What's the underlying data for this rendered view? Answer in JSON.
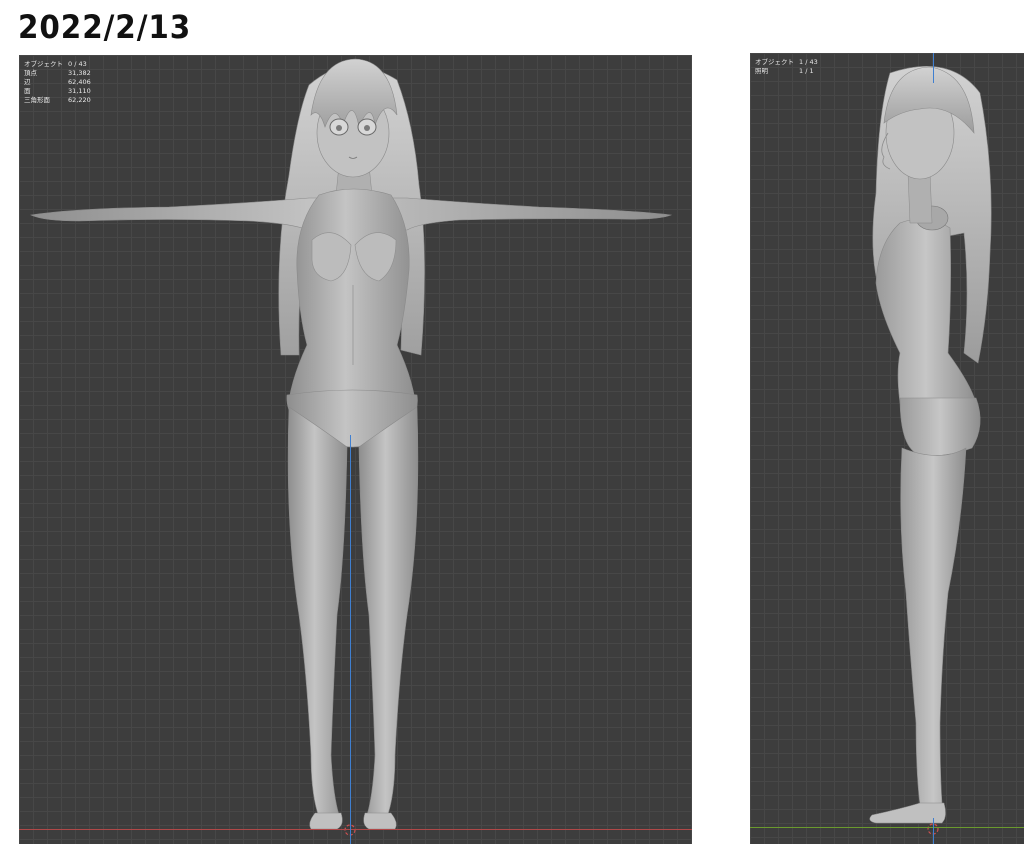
{
  "header": {
    "date": "2022/2/13"
  },
  "front_view": {
    "stats": [
      {
        "label": "オブジェクト",
        "value": "0 / 43"
      },
      {
        "label": "頂点",
        "value": "31,382"
      },
      {
        "label": "辺",
        "value": "62,406"
      },
      {
        "label": "面",
        "value": "31,110"
      },
      {
        "label": "三角形面",
        "value": "62,220"
      }
    ]
  },
  "side_view": {
    "stats": [
      {
        "label": "オブジェクト",
        "value": "1 / 43"
      },
      {
        "label": "照明",
        "value": "1 / 1"
      }
    ]
  },
  "colors": {
    "viewport_bg": "#3d3d3d",
    "grid_line": "#474747",
    "x_axis": "#b04848",
    "y_axis": "#6a9a2e",
    "z_axis": "#3f7fd0",
    "mesh": "#b5b5b5",
    "title": "#111111"
  }
}
